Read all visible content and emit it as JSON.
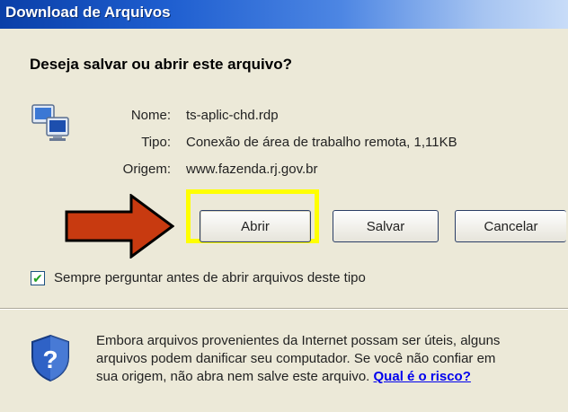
{
  "window": {
    "title": "Download de Arquivos"
  },
  "dialog": {
    "question": "Deseja salvar ou abrir este arquivo?",
    "file_icon": "remote-desktop-icon",
    "fields": {
      "name_label": "Nome:",
      "name_value": "ts-aplic-chd.rdp",
      "type_label": "Tipo:",
      "type_value": "Conexão de área de trabalho remota, 1,11KB",
      "origin_label": "Origem:",
      "origin_value": "www.fazenda.rj.gov.br"
    },
    "buttons": {
      "open": "Abrir",
      "save": "Salvar",
      "cancel": "Cancelar"
    },
    "always_ask": {
      "checked": true,
      "label": "Sempre perguntar antes de abrir arquivos deste tipo"
    },
    "warning": {
      "line1": "Embora arquivos provenientes da Internet possam ser úteis, alguns",
      "line2": "arquivos podem danificar seu computador. Se você não confiar em",
      "line3": "sua origem, não abra nem salve este arquivo. ",
      "link": "Qual é o risco?"
    }
  },
  "annotations": {
    "arrow_color": "#c83a10",
    "highlight_color": "#ffff00"
  }
}
